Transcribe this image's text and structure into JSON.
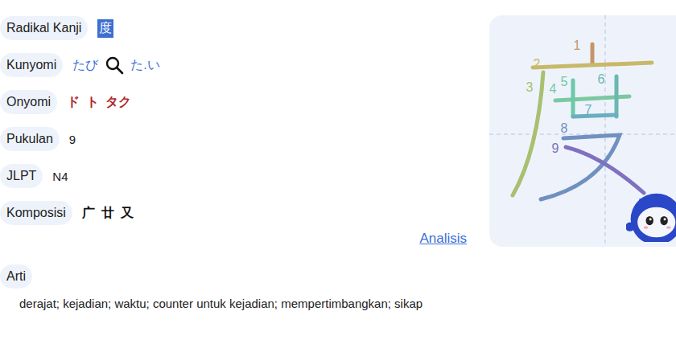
{
  "rows": [
    {
      "label": "Radikal Kanji",
      "kind": "highlight",
      "values": [
        "度"
      ]
    },
    {
      "label": "Kunyomi",
      "kind": "kun",
      "values": [
        "たび",
        "た.い"
      ]
    },
    {
      "label": "Onyomi",
      "kind": "on",
      "values": [
        "ド",
        "ト",
        "タク"
      ]
    },
    {
      "label": "Pukulan",
      "kind": "plain",
      "values": [
        "9"
      ]
    },
    {
      "label": "JLPT",
      "kind": "plain",
      "values": [
        "N4"
      ]
    },
    {
      "label": "Komposisi",
      "kind": "parts",
      "values": [
        "广",
        "廿",
        "又"
      ]
    }
  ],
  "analysis_link": "Analisis",
  "meaning": {
    "label": "Arti",
    "text": "derajat; kejadian; waktu; counter untuk kejadian; mempertimbangkan; sikap"
  },
  "strokes": [
    {
      "number": "1",
      "color": "#c4956a"
    },
    {
      "number": "2",
      "color": "#c8b96a"
    },
    {
      "number": "3",
      "color": "#a8c070"
    },
    {
      "number": "4",
      "color": "#7cc8a0"
    },
    {
      "number": "5",
      "color": "#6cc8a8"
    },
    {
      "number": "6",
      "color": "#6ab8b0"
    },
    {
      "number": "7",
      "color": "#6aaec0"
    },
    {
      "number": "8",
      "color": "#7090c0"
    },
    {
      "number": "9",
      "color": "#8070c0"
    }
  ]
}
